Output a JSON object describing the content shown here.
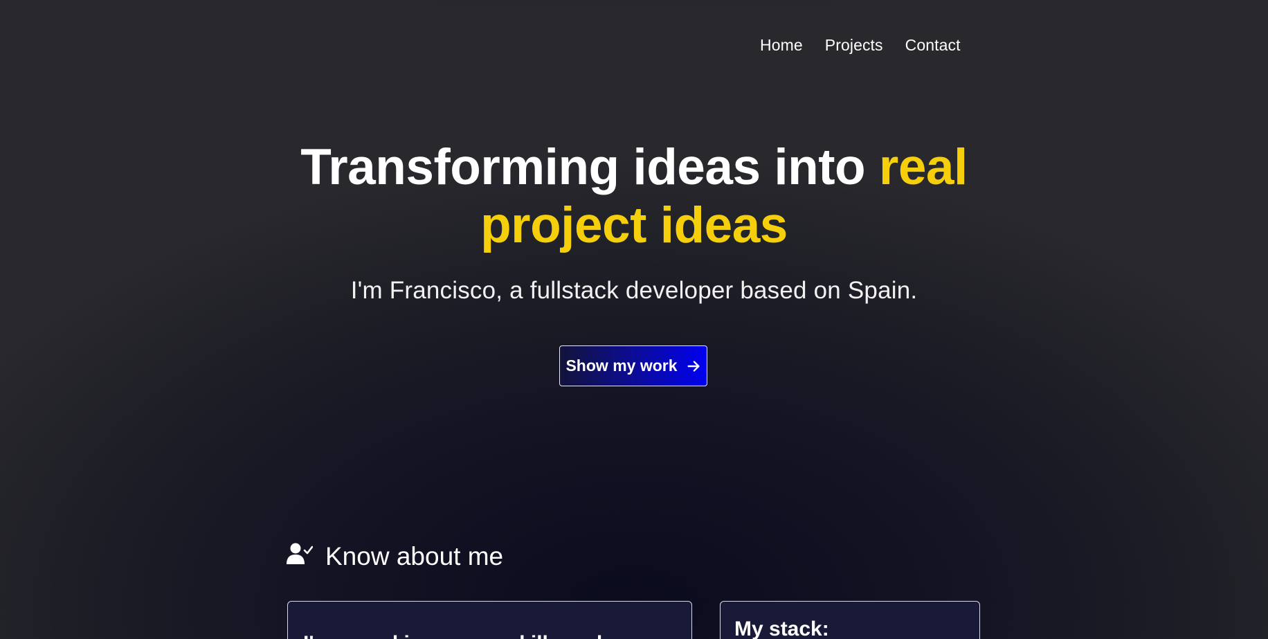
{
  "nav": {
    "items": [
      {
        "label": "Home"
      },
      {
        "label": "Projects"
      },
      {
        "label": "Contact"
      }
    ]
  },
  "hero": {
    "title_part1": "Transforming ideas into ",
    "title_highlight_1": "real",
    "title_highlight_2": "project ideas",
    "subtitle": "I'm Francisco, a fullstack developer based on Spain.",
    "cta_label": "Show my work",
    "cta_icon": "arrow-right-icon",
    "accent_color": "#f5cf0c"
  },
  "about": {
    "heading": "Know about me",
    "heading_icon": "user-check-icon",
    "card_left_text": "I'm a working on my skills and",
    "card_right_title": "My stack:"
  }
}
